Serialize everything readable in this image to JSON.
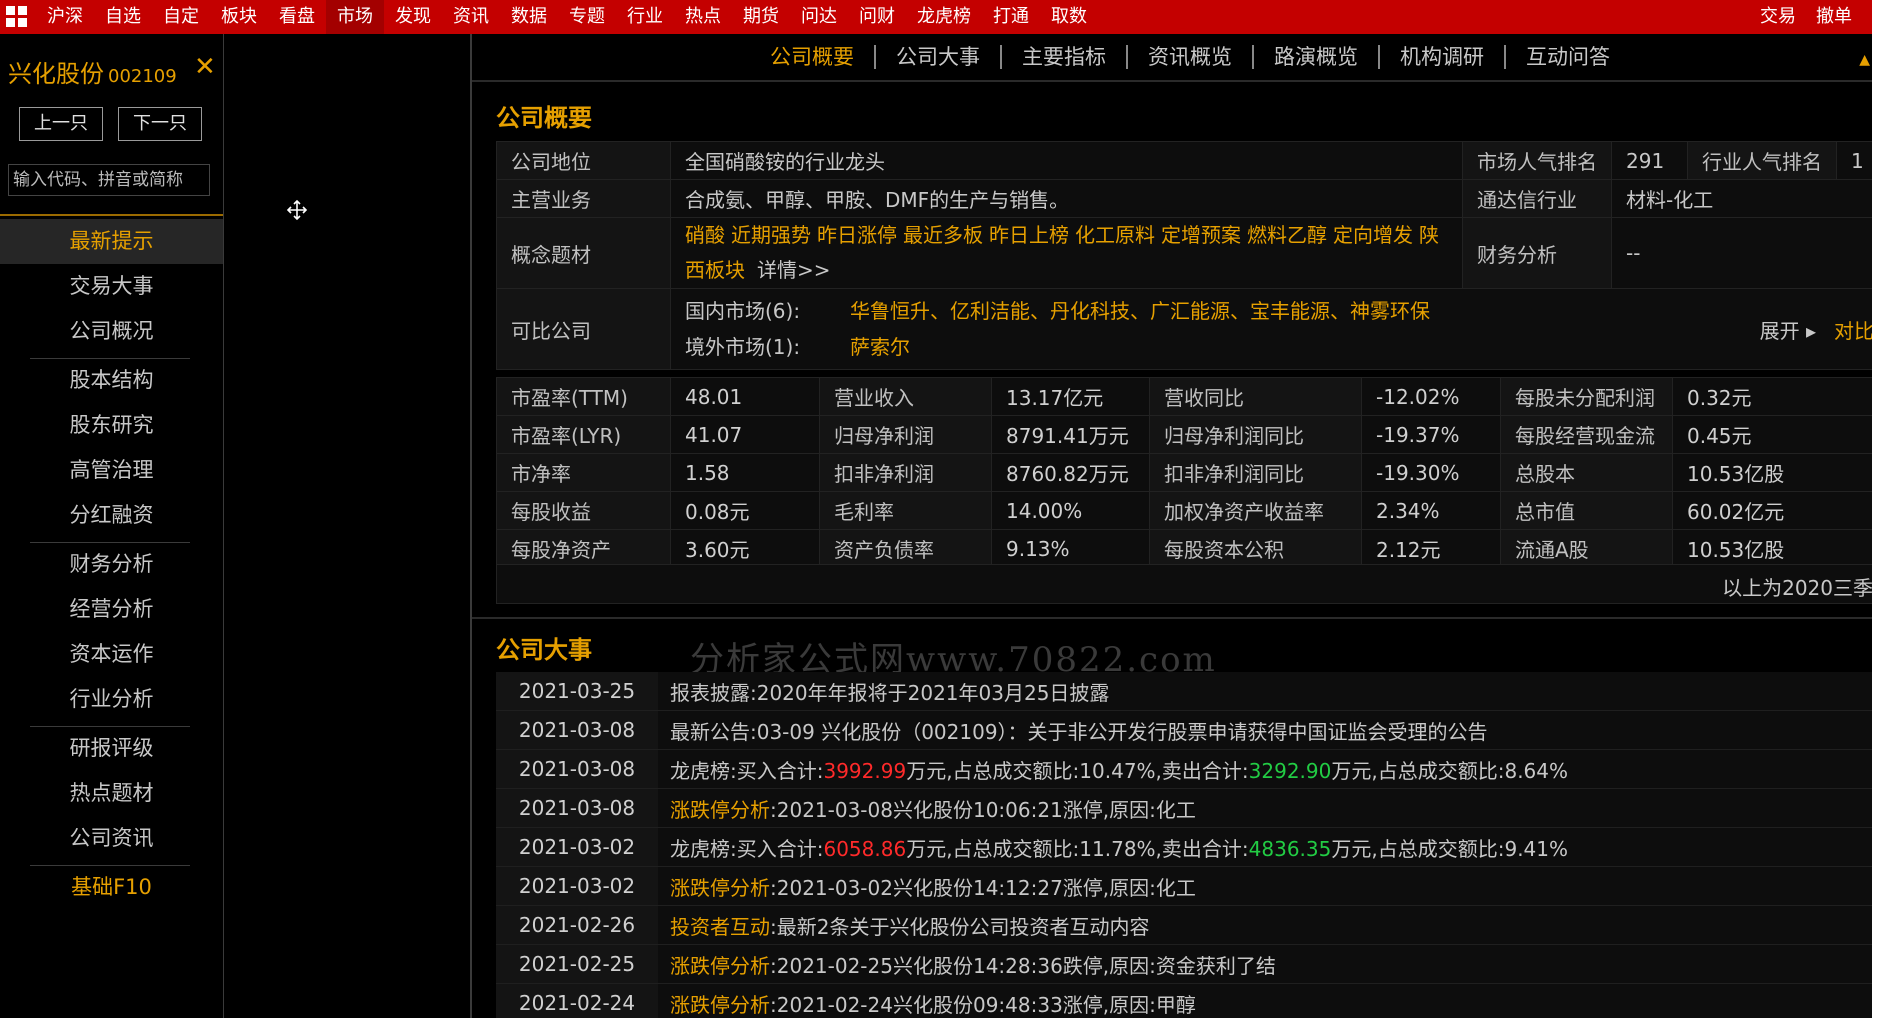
{
  "menubar": {
    "items": [
      "沪深",
      "自选",
      "自定",
      "板块",
      "看盘",
      "市场",
      "发现",
      "资讯",
      "数据",
      "专题",
      "行业",
      "热点",
      "期货",
      "问达",
      "问财",
      "龙虎榜",
      "打通",
      "取数"
    ],
    "active": "市场",
    "right": [
      "交易",
      "撤单"
    ]
  },
  "sidebar": {
    "stock_name": "兴化股份",
    "stock_code": "002109",
    "close": "✕",
    "prev": "上一只",
    "next": "下一只",
    "search_placeholder": "输入代码、拼音或简称",
    "items": [
      "最新提示",
      "交易大事",
      "公司概况",
      "股本结构",
      "股东研究",
      "高管治理",
      "分红融资",
      "财务分析",
      "经营分析",
      "资本运作",
      "行业分析",
      "研报评级",
      "热点题材",
      "公司资讯",
      "基础F10"
    ]
  },
  "tabs": [
    "公司概要",
    "公司大事",
    "主要指标",
    "资讯概览",
    "路演概览",
    "机构调研",
    "互动问答"
  ],
  "overview": {
    "title": "公司概要",
    "position_label": "公司地位",
    "position_value": "全国硝酸铵的行业龙头",
    "market_rank_label": "市场人气排名",
    "market_rank_value": "291",
    "industry_rank_label": "行业人气排名",
    "industry_rank_value": "1",
    "business_label": "主营业务",
    "business_value": "合成氨、甲醇、甲胺、DMF的生产与销售。",
    "tdx_industry_label": "通达信行业",
    "tdx_industry_value": "材料-化工",
    "concepts_label": "概念题材",
    "concepts": [
      "硝酸",
      "近期强势",
      "昨日涨停",
      "最近多板",
      "昨日上榜",
      "化工原料",
      "定增预案",
      "燃料乙醇",
      "定向增发",
      "陕西板块"
    ],
    "concepts_more": "详情>>",
    "finance_label": "财务分析",
    "finance_value": "--",
    "comparable_label": "可比公司",
    "domestic_label": "国内市场(6):",
    "domestic_list": "华鲁恒升、亿利洁能、丹化科技、广汇能源、宝丰能源、神雾环保",
    "overseas_label": "境外市场(1):",
    "overseas_list": "萨索尔",
    "expand": "展开 ▸",
    "compare": "对比"
  },
  "financials": [
    [
      "市盈率(TTM)",
      "48.01",
      "营业收入",
      "13.17亿元",
      "营收同比",
      "-12.02%",
      "每股未分配利润",
      "0.32元"
    ],
    [
      "市盈率(LYR)",
      "41.07",
      "归母净利润",
      "8791.41万元",
      "归母净利润同比",
      "-19.37%",
      "每股经营现金流",
      "0.45元"
    ],
    [
      "市净率",
      "1.58",
      "扣非净利润",
      "8760.82万元",
      "扣非净利润同比",
      "-19.30%",
      "总股本",
      "10.53亿股"
    ],
    [
      "每股收益",
      "0.08元",
      "毛利率",
      "14.00%",
      "加权净资产收益率",
      "2.34%",
      "总市值",
      "60.02亿元"
    ],
    [
      "每股净资产",
      "3.60元",
      "资产负债率",
      "9.13%",
      "每股资本公积",
      "2.12元",
      "流通A股",
      "10.53亿股"
    ]
  ],
  "fin_note": "以上为2020三季",
  "events_title": "公司大事",
  "watermark": "分析家公式网www.70822.com",
  "events": [
    {
      "date": "2021-03-25",
      "parts": [
        {
          "t": "报表披露:2020年年报将于2021年03月25日披露",
          "c": ""
        }
      ]
    },
    {
      "date": "2021-03-08",
      "parts": [
        {
          "t": "最新公告:03-09 兴化股份（002109）：关于非公开发行股票申请获得中国证监会受理的公告",
          "c": ""
        }
      ]
    },
    {
      "date": "2021-03-08",
      "parts": [
        {
          "t": "龙虎榜:买入合计:",
          "c": ""
        },
        {
          "t": "3992.99",
          "c": "red"
        },
        {
          "t": "万元,占总成交额比:10.47%,卖出合计:",
          "c": ""
        },
        {
          "t": "3292.90",
          "c": "green"
        },
        {
          "t": "万元,占总成交额比:8.64%",
          "c": ""
        }
      ]
    },
    {
      "date": "2021-03-08",
      "parts": [
        {
          "t": "涨跌停分析",
          "c": "tag"
        },
        {
          "t": ":2021-03-08兴化股份10:06:21涨停,原因:化工",
          "c": ""
        }
      ]
    },
    {
      "date": "2021-03-02",
      "parts": [
        {
          "t": "龙虎榜:买入合计:",
          "c": ""
        },
        {
          "t": "6058.86",
          "c": "red"
        },
        {
          "t": "万元,占总成交额比:11.78%,卖出合计:",
          "c": ""
        },
        {
          "t": "4836.35",
          "c": "green"
        },
        {
          "t": "万元,占总成交额比:9.41%",
          "c": ""
        }
      ]
    },
    {
      "date": "2021-03-02",
      "parts": [
        {
          "t": "涨跌停分析",
          "c": "tag"
        },
        {
          "t": ":2021-03-02兴化股份14:12:27涨停,原因:化工",
          "c": ""
        }
      ]
    },
    {
      "date": "2021-02-26",
      "parts": [
        {
          "t": "投资者互动",
          "c": "tag"
        },
        {
          "t": ":最新2条关于兴化股份公司投资者互动内容",
          "c": ""
        }
      ]
    },
    {
      "date": "2021-02-25",
      "parts": [
        {
          "t": "涨跌停分析",
          "c": "tag"
        },
        {
          "t": ":2021-02-25兴化股份14:28:36跌停,原因:资金获利了结",
          "c": ""
        }
      ]
    },
    {
      "date": "2021-02-24",
      "parts": [
        {
          "t": "涨跌停分析",
          "c": "tag"
        },
        {
          "t": ":2021-02-24兴化股份09:48:33涨停,原因:甲醇",
          "c": ""
        }
      ]
    }
  ]
}
